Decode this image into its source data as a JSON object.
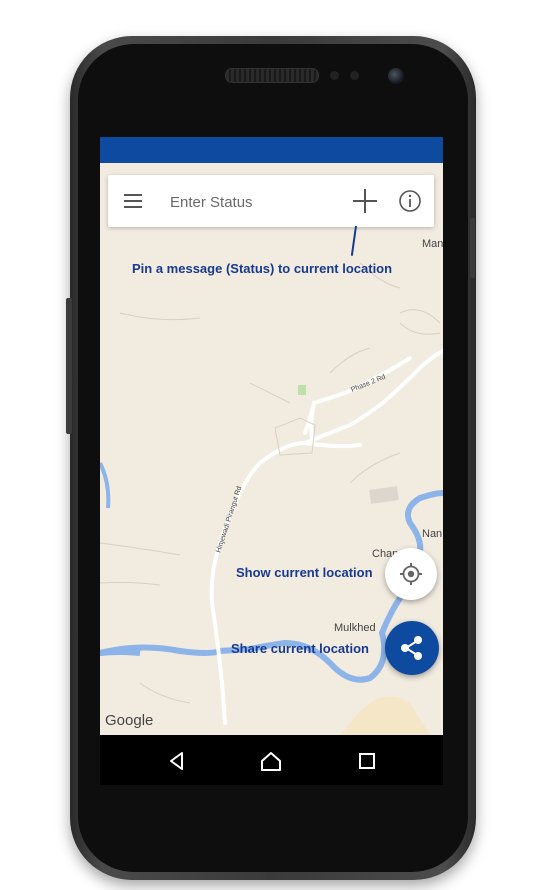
{
  "search": {
    "placeholder": "Enter Status"
  },
  "annotations": {
    "pin": "Pin a message (Status) to current location",
    "show_location": "Show current location",
    "share_location": "Share current location"
  },
  "map": {
    "labels": {
      "mulkhed": "Mulkhed",
      "chan": "Chan",
      "nan": "Nan",
      "man": "Man",
      "phase2": "Phase 2 Rd",
      "hinjewadi": "Hinjewadi Pirangut Rd"
    },
    "watermark": "Google"
  },
  "icons": {
    "menu": "menu-icon",
    "add": "add-icon",
    "info": "info-icon",
    "location": "gps-location-icon",
    "share": "share-icon",
    "back": "back-icon",
    "home": "home-icon",
    "recents": "recents-icon"
  },
  "colors": {
    "primary": "#0f4aa1",
    "annotation": "#173a8f",
    "map_background": "#f2ebe0",
    "water": "#8db4e8"
  }
}
